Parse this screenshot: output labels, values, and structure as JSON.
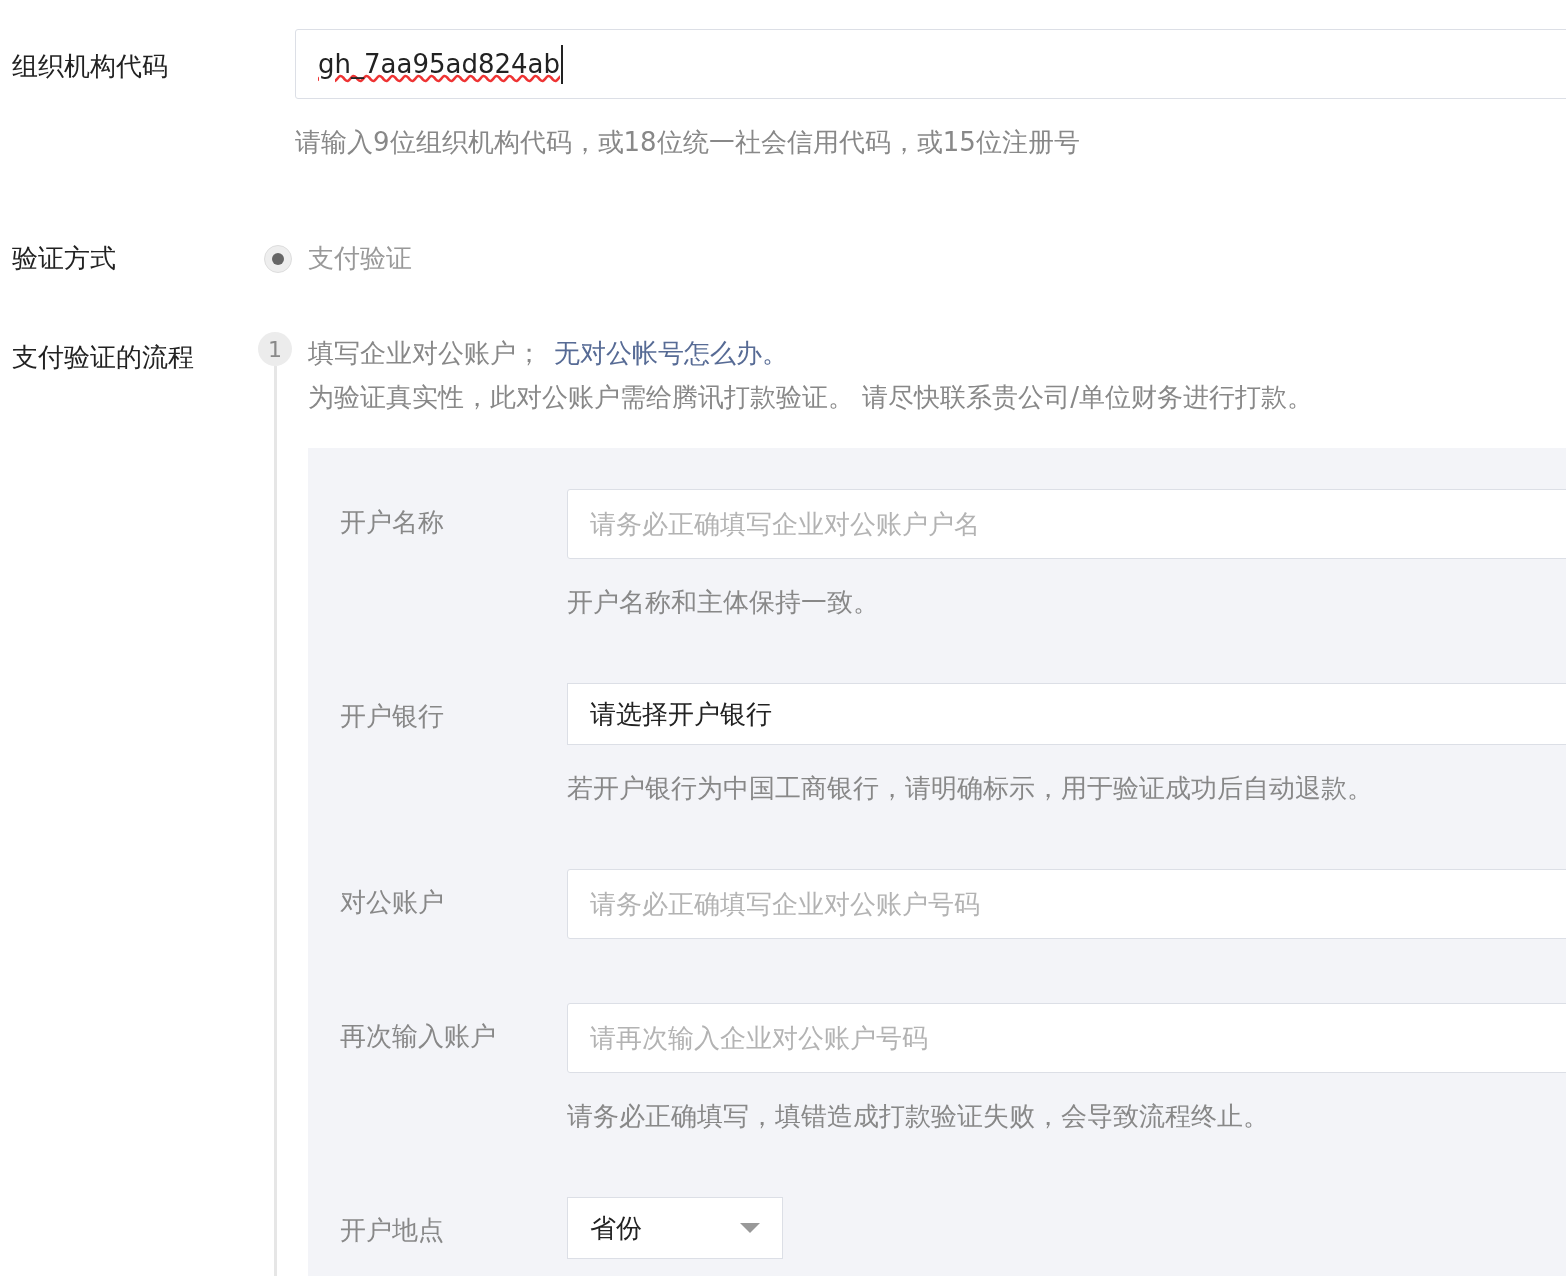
{
  "org_code": {
    "label": "组织机构代码",
    "value": "gh_7aa95ad824ab",
    "hint": "请输入9位组织机构代码，或18位统一社会信用代码，或15位注册号"
  },
  "verification": {
    "label": "验证方式",
    "options": [
      {
        "label": "支付验证",
        "selected": true
      }
    ]
  },
  "process": {
    "label": "支付验证的流程",
    "step": "1",
    "intro": "填写企业对公账户；",
    "link": "无对公帐号怎么办。",
    "note": "为验证真实性，此对公账户需给腾讯打款验证。 请尽快联系贵公司/单位财务进行打款。",
    "fields": [
      {
        "kind": "input",
        "label": "开户名称",
        "placeholder": "请务必正确填写企业对公账户户名",
        "hint": "开户名称和主体保持一致。"
      },
      {
        "kind": "select",
        "label": "开户银行",
        "value": "请选择开户银行",
        "hint": "若开户银行为中国工商银行，请明确标示，用于验证成功后自动退款。"
      },
      {
        "kind": "input",
        "label": "对公账户",
        "placeholder": "请务必正确填写企业对公账户号码"
      },
      {
        "kind": "input",
        "label": "再次输入账户",
        "placeholder": "请再次输入企业对公账户号码",
        "hint": "请务必正确填写，填错造成打款验证失败，会导致流程终止。"
      },
      {
        "kind": "dropdown",
        "label": "开户地点",
        "value": "省份"
      }
    ]
  }
}
